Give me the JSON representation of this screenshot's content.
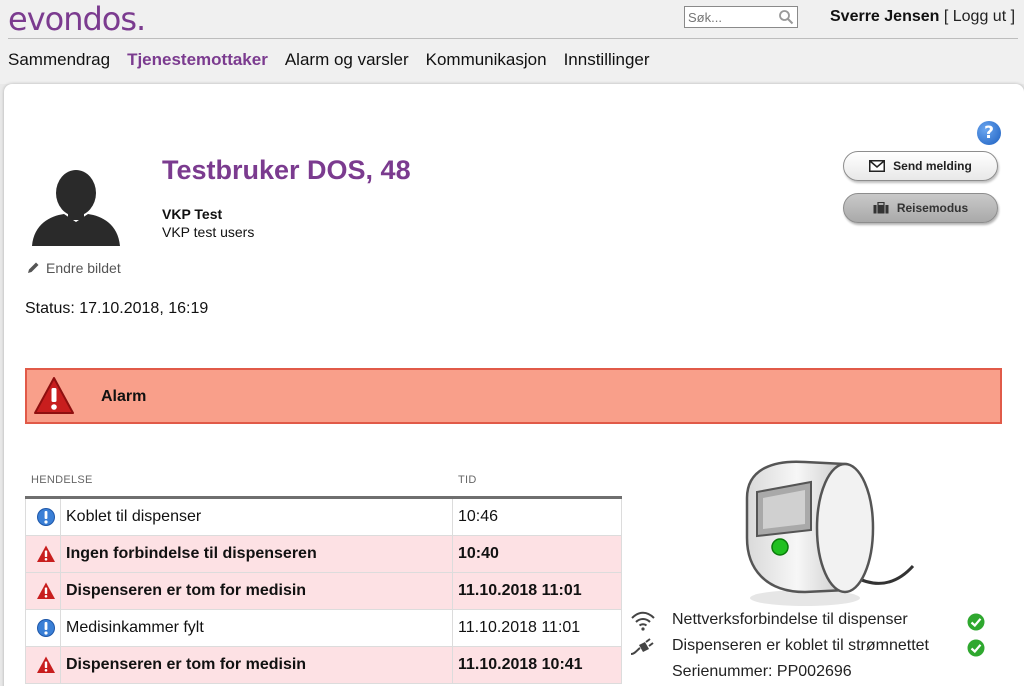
{
  "header": {
    "logo_text": "evondos",
    "search_placeholder": "Søk...",
    "user_name": "Sverre Jensen",
    "logout_label": "[ Logg ut ]"
  },
  "nav": {
    "tabs": [
      {
        "label": "Sammendrag",
        "active": false
      },
      {
        "label": "Tjenestemottaker",
        "active": true
      },
      {
        "label": "Alarm og varsler",
        "active": false
      },
      {
        "label": "Kommunikasjon",
        "active": false
      },
      {
        "label": "Innstillinger",
        "active": false
      }
    ]
  },
  "profile": {
    "name": "Testbruker DOS, 48",
    "organization": "VKP Test",
    "group": "VKP test users",
    "edit_photo_label": "Endre bildet",
    "status": "Status: 17.10.2018, 16:19"
  },
  "actions": {
    "send_message_label": "Send melding",
    "travel_mode_label": "Reisemodus",
    "help_label": "?"
  },
  "alarm": {
    "label": "Alarm"
  },
  "events": {
    "col_event": "HENDELSE",
    "col_time": "TID",
    "rows": [
      {
        "icon": "info-icon",
        "event": "Koblet til dispenser",
        "time": "10:46",
        "alert": false
      },
      {
        "icon": "warning-icon",
        "event": "Ingen forbindelse til dispenseren",
        "time": "10:40",
        "alert": true
      },
      {
        "icon": "warning-icon",
        "event": "Dispenseren er tom for medisin",
        "time": "11.10.2018 11:01",
        "alert": true
      },
      {
        "icon": "info-icon",
        "event": "Medisinkammer fylt",
        "time": "11.10.2018 11:01",
        "alert": false
      },
      {
        "icon": "warning-icon",
        "event": "Dispenseren er tom for medisin",
        "time": "11.10.2018 10:41",
        "alert": true
      }
    ]
  },
  "device": {
    "network_label": "Nettverksforbindelse til dispenser",
    "power_label": "Dispenseren er koblet til strømnettet",
    "serial_label": "Serienummer: PP002696"
  },
  "colors": {
    "brand": "#7b3b8f",
    "alarm_bg": "#f99f8a",
    "alert_row_bg": "#fde1e4",
    "ok_green": "#2fa82f"
  }
}
